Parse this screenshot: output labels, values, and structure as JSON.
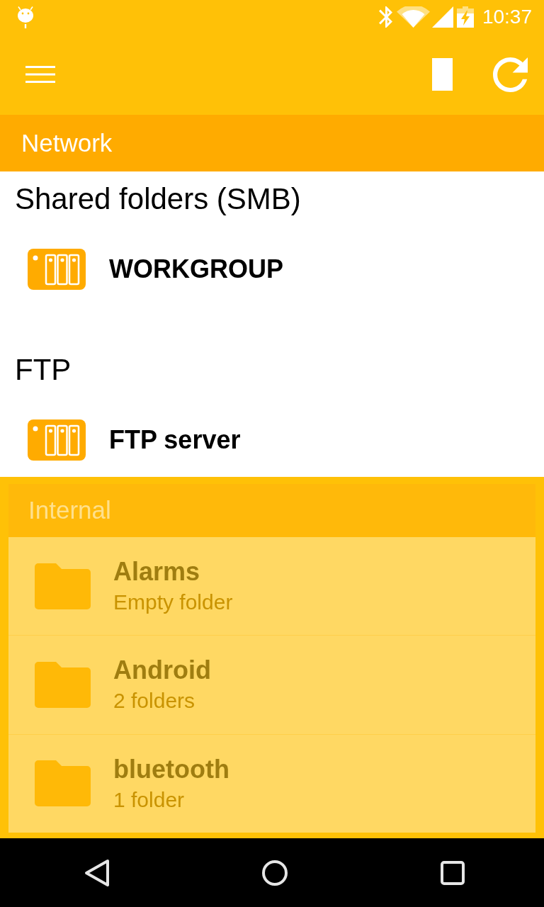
{
  "status_bar": {
    "time": "10:37"
  },
  "network": {
    "header": "Network",
    "groups": [
      {
        "title": "Shared folders (SMB)",
        "servers": [
          {
            "name": "WORKGROUP"
          }
        ]
      },
      {
        "title": "FTP",
        "servers": [
          {
            "name": "FTP server"
          }
        ]
      }
    ]
  },
  "internal": {
    "header": "Internal",
    "folders": [
      {
        "name": "Alarms",
        "details": "Empty folder"
      },
      {
        "name": "Android",
        "details": "2 folders"
      },
      {
        "name": "bluetooth",
        "details": "1 folder"
      }
    ]
  }
}
